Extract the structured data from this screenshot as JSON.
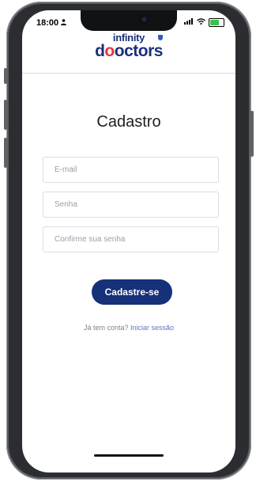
{
  "status_bar": {
    "time": "18:00",
    "person_icon": "person-icon",
    "signal_icon": "signal-icon",
    "wifi_icon": "wifi-icon",
    "battery_icon": "battery-charging-icon",
    "battery_color": "#3cc04d"
  },
  "logo": {
    "line1": "infinity",
    "line2_start": "d",
    "line2_o1": "o",
    "line2_o2": "o",
    "line2_end": "ctors",
    "brand_color": "#1c2f7a",
    "accent_color": "#e5333d"
  },
  "form": {
    "title": "Cadastro",
    "email_placeholder": "E-mail",
    "password_placeholder": "Senha",
    "confirm_placeholder": "Confirme sua senha",
    "submit_label": "Cadastre-se",
    "submit_color": "#16307a"
  },
  "footer": {
    "prompt": "Já tem conta?",
    "login_link": "Iniciar sessão"
  }
}
